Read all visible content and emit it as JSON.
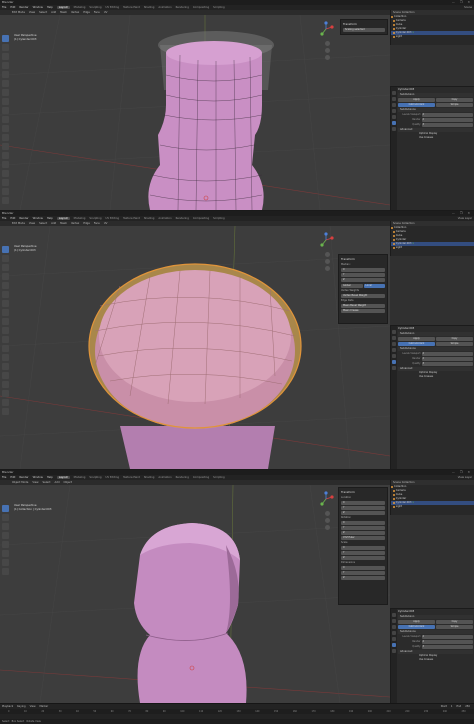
{
  "app": {
    "title": "Blender",
    "window_controls": "— ❐ ✕"
  },
  "menu": {
    "items": [
      "File",
      "Edit",
      "Render",
      "Window",
      "Help"
    ],
    "workspaces": [
      "Layout",
      "Modeling",
      "Sculpting",
      "UV Editing",
      "Texture Paint",
      "Shading",
      "Animation",
      "Rendering",
      "Compositing",
      "Scripting"
    ],
    "active_workspace": "Layout",
    "scene_label": "Scene",
    "view_layer_label": "View Layer"
  },
  "shot1": {
    "header": [
      "Edit Mode",
      "View",
      "Select",
      "Add",
      "Mesh",
      "Vertex",
      "Edge",
      "Face",
      "UV"
    ],
    "view_info": [
      "User Perspective",
      "(1) Cylender.003"
    ],
    "panel_title": "Transform",
    "panel_rows": [
      "Scaling selected"
    ]
  },
  "shot2": {
    "header": [
      "Edit Mode",
      "View",
      "Select",
      "Add",
      "Mesh",
      "Vertex",
      "Edge",
      "Face",
      "UV"
    ],
    "view_info": [
      "User Perspective",
      "(1) Cylinder.003"
    ],
    "panel_title": "Transform",
    "panel_rows": [
      "Median:",
      "X",
      "Y",
      "Z",
      "Global",
      "Local"
    ],
    "panel_sections": [
      "Vertex Weights",
      "Vertex Bevel Weight",
      "Edge Data",
      "Mean Bevel Weight",
      "Mean Crease"
    ]
  },
  "shot3": {
    "header": [
      "Object Mode",
      "View",
      "Select",
      "Add",
      "Object"
    ],
    "view_info": [
      "User Perspective",
      "(1) Collection | Cylinder.003"
    ],
    "panel_title": "Transform",
    "panel_sections": [
      "Location",
      "Rotation",
      "XYZ Euler",
      "Scale",
      "Dimensions"
    ],
    "axis_rows": [
      "X",
      "Y",
      "Z"
    ]
  },
  "outliner": {
    "title": "Scene Collection",
    "items": [
      {
        "name": "Collection",
        "selected": false
      },
      {
        "name": "Camera",
        "selected": false
      },
      {
        "name": "Cube",
        "selected": false
      },
      {
        "name": "Cylinder",
        "selected": false
      },
      {
        "name": "Cylinder.003",
        "selected": true
      },
      {
        "name": "Light",
        "selected": false
      }
    ]
  },
  "properties": {
    "object_name": "Cylinder.003",
    "modifier_name": "Subdivision",
    "mode_buttons": [
      "Catmull-Clark",
      "Simple"
    ],
    "section": "Subdivisions",
    "rows": [
      {
        "key": "Levels Viewport",
        "value": "2"
      },
      {
        "key": "Render",
        "value": "2"
      },
      {
        "key": "Quality",
        "value": "3"
      }
    ],
    "advanced": "Advanced",
    "checks": [
      "Optimal Display",
      "Use Creases"
    ],
    "apply_label": "Apply",
    "copy_label": "Copy"
  },
  "timeline": {
    "menu": [
      "Playback",
      "Keying",
      "View",
      "Marker"
    ],
    "ticks": [
      "0",
      "10",
      "20",
      "30",
      "40",
      "50",
      "60",
      "70",
      "80",
      "90",
      "100",
      "110",
      "120",
      "130",
      "140",
      "150",
      "160",
      "170",
      "180",
      "190",
      "200",
      "210",
      "220",
      "230",
      "240",
      "250"
    ],
    "start_label": "Start",
    "start": "1",
    "end_label": "End",
    "end": "250"
  },
  "status": {
    "left": "Select",
    "middle": "Box Select",
    "right": "Rotate View"
  },
  "colors": {
    "mesh_pink": "#c98fc4",
    "mesh_pink_dark": "#9a6a96",
    "selection_orange": "#e0943a",
    "accent_blue": "#4772b3",
    "viewport_bg": "#3d3d3d"
  }
}
